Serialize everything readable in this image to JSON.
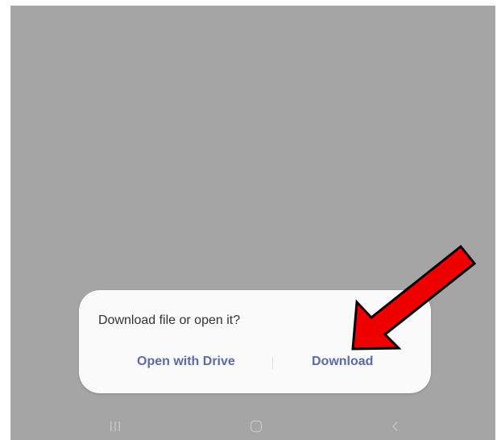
{
  "dialog": {
    "title": "Download file or open it?",
    "open_with_drive_label": "Open with Drive",
    "download_label": "Download"
  },
  "navbar": {
    "recents_icon": "recents-icon",
    "home_icon": "home-icon",
    "back_icon": "back-icon"
  },
  "colors": {
    "scrim": "#a5a5a5",
    "dialog_background": "#fafafa",
    "action_text": "#5c6aa8",
    "annotation_arrow": "#ee0000"
  }
}
